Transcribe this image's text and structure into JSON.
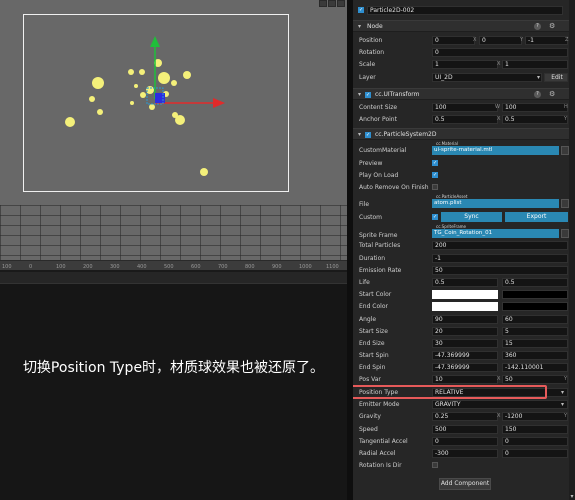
{
  "inspector": {
    "node_name": "Particle2D-002",
    "sections": {
      "node": "Node",
      "uitransform": "cc.UITransform",
      "particle": "cc.ParticleSystem2D"
    },
    "node": {
      "position_label": "Position",
      "position": [
        "0",
        "0",
        "-1"
      ],
      "rotation_label": "Rotation",
      "rotation": "0",
      "scale_label": "Scale",
      "scale": [
        "1",
        "1"
      ],
      "layer_label": "Layer",
      "layer": "UI_2D",
      "edit_label": "Edit"
    },
    "uitransform": {
      "content_size_label": "Content Size",
      "content_size": [
        "100",
        "100"
      ],
      "anchor_label": "Anchor Point",
      "anchor": [
        "0.5",
        "0.5"
      ]
    },
    "particle": {
      "custom_material_label": "CustomMaterial",
      "custom_material_tag": "cc.Material",
      "custom_material_value": "ui-sprite-material.mtl",
      "preview_label": "Preview",
      "play_on_load_label": "Play On Load",
      "auto_remove_label": "Auto Remove On Finish",
      "file_label": "File",
      "file_tag": "cc.ParticleAsset",
      "file_value": "atom.plist",
      "custom_label": "Custom",
      "sync_label": "Sync",
      "export_label": "Export",
      "sprite_frame_label": "Sprite Frame",
      "sprite_frame_tag": "cc.SpriteFrame",
      "sprite_frame_value": "TG_Coin_Rotation_01",
      "total_particles_label": "Total Particles",
      "total_particles": "200",
      "duration_label": "Duration",
      "duration": "-1",
      "emission_rate_label": "Emission Rate",
      "emission_rate": "50",
      "life_label": "Life",
      "life": [
        "0.5",
        "0.5"
      ],
      "start_color_label": "Start Color",
      "end_color_label": "End Color",
      "angle_label": "Angle",
      "angle": [
        "90",
        "60"
      ],
      "start_size_label": "Start Size",
      "start_size": [
        "20",
        "5"
      ],
      "end_size_label": "End Size",
      "end_size": [
        "30",
        "15"
      ],
      "start_spin_label": "Start Spin",
      "start_spin": [
        "-47.369999",
        "360"
      ],
      "end_spin_label": "End Spin",
      "end_spin": [
        "-47.369999",
        "-142.110001"
      ],
      "pos_var_label": "Pos Var",
      "pos_var": [
        "10",
        "50"
      ],
      "position_type_label": "Position Type",
      "position_type": "RELATIVE",
      "emitter_mode_label": "Emitter Mode",
      "emitter_mode": "GRAVITY",
      "gravity_label": "Gravity",
      "gravity": [
        "0.25",
        "-1200"
      ],
      "speed_label": "Speed",
      "speed": [
        "500",
        "150"
      ],
      "tangential_label": "Tangential Accel",
      "tangential": [
        "0",
        "0"
      ],
      "radial_label": "Radial Accel",
      "radial": [
        "-300",
        "0"
      ],
      "rotation_is_dir_label": "Rotation Is Dir"
    },
    "axis": {
      "x": "X",
      "y": "Y",
      "z": "Z",
      "w": "W",
      "h": "H"
    },
    "add_component_label": "Add Component"
  },
  "scene": {
    "ruler_ticks": [
      "100",
      "0",
      "100",
      "200",
      "300",
      "400",
      "500",
      "600",
      "700",
      "800",
      "900",
      "1000",
      "1100"
    ]
  },
  "caption": "切换Position Type时，材质球效果也被还原了。",
  "colors": {
    "accent": "#2a88b3",
    "highlight": "#e65a5a",
    "particle": "#f4f07a"
  }
}
